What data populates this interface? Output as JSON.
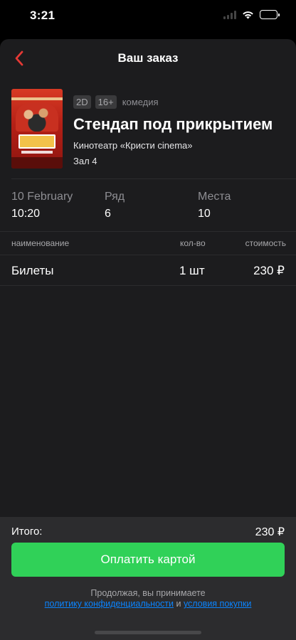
{
  "status": {
    "time": "3:21"
  },
  "header": {
    "title": "Ваш заказ"
  },
  "movie": {
    "format": "2D",
    "age_rating": "16+",
    "genre": "комедия",
    "title": "Стендап под прикрытием",
    "cinema": "Кинотеатр «Кристи cinema»",
    "hall": "Зал 4"
  },
  "session": {
    "date": "10 February",
    "time": "10:20",
    "row_label": "Ряд",
    "row_value": "6",
    "seats_label": "Места",
    "seats_value": "10"
  },
  "order_table": {
    "headers": {
      "name": "наименование",
      "qty": "кол-во",
      "cost": "стоимость"
    },
    "rows": [
      {
        "name": "Билеты",
        "qty": "1 шт",
        "cost": "230 ₽"
      }
    ]
  },
  "footer": {
    "total_label": "Итого:",
    "total_value": "230 ₽",
    "pay_label": "Оплатить картой",
    "consent_text": "Продолжая, вы принимаете",
    "privacy_link": "политику конфиденциальности",
    "and_text": "и",
    "terms_link": "условия покупки"
  },
  "colors": {
    "accent_red": "#e53935",
    "pay_green": "#30d158",
    "link_blue": "#0a84ff",
    "sheet_bg": "#1c1c1e",
    "footer_bg": "#2c2c2e"
  },
  "icons": {
    "back": "chevron-left-icon",
    "signal": "cellular-signal-icon",
    "wifi": "wifi-icon",
    "battery": "battery-icon"
  }
}
